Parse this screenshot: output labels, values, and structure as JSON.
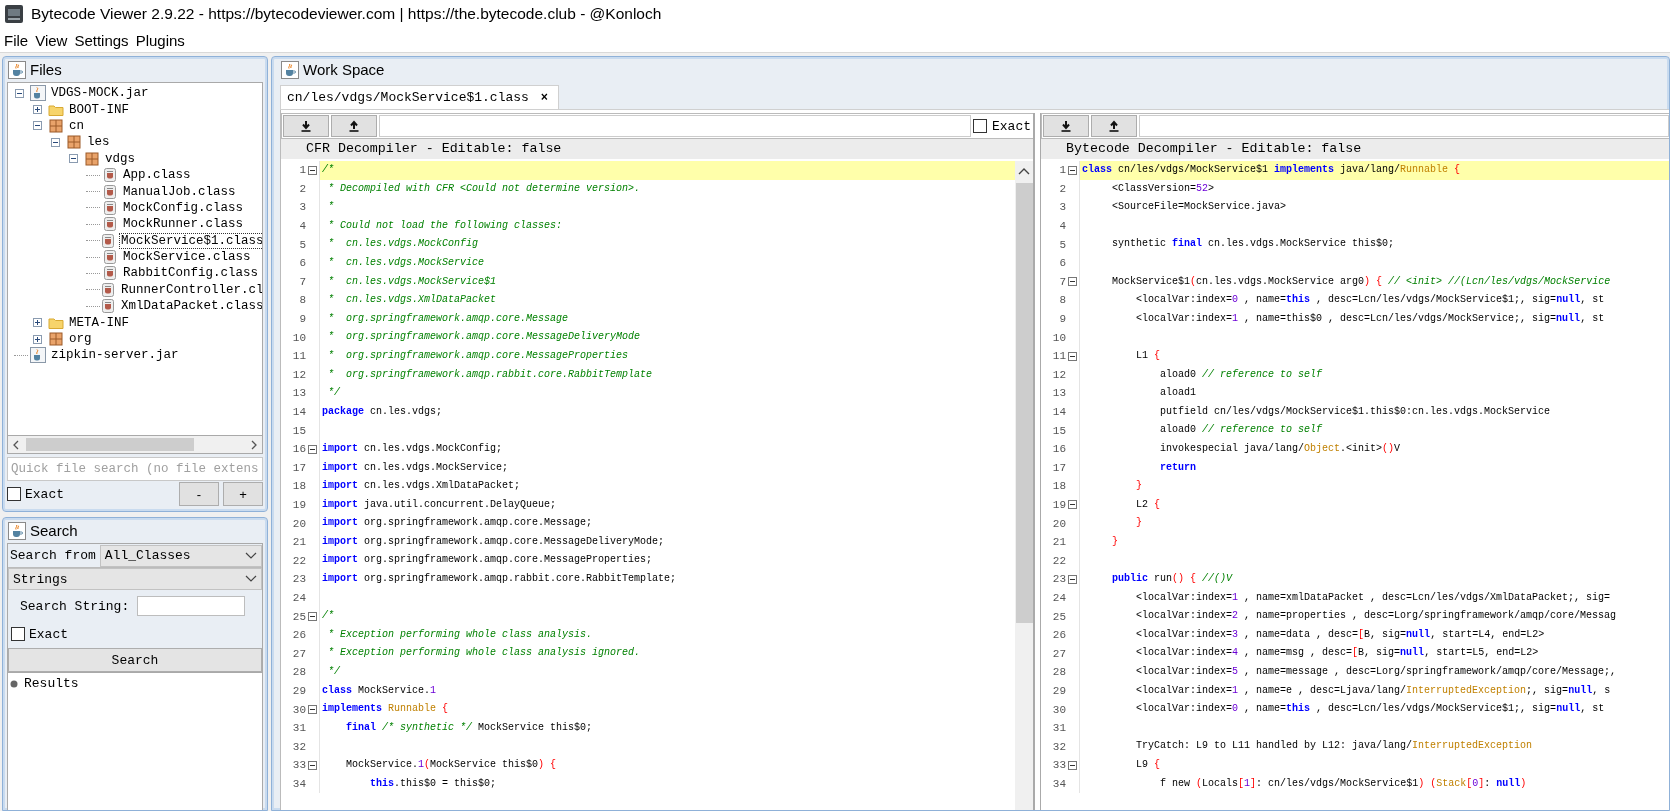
{
  "window": {
    "title": "Bytecode Viewer 2.9.22 - https://bytecodeviewer.com | https://the.bytecode.club - @Konloch"
  },
  "menu": [
    "File",
    "View",
    "Settings",
    "Plugins"
  ],
  "files_panel": {
    "title": "Files",
    "tree": [
      {
        "label": "VDGS-MOCK.jar",
        "kind": "jar",
        "expanded": true,
        "selected": false,
        "children": [
          {
            "label": "BOOT-INF",
            "kind": "folder",
            "expanded": false,
            "selected": false
          },
          {
            "label": "cn",
            "kind": "package",
            "expanded": true,
            "selected": false,
            "children": [
              {
                "label": "les",
                "kind": "package",
                "expanded": true,
                "selected": false,
                "children": [
                  {
                    "label": "vdgs",
                    "kind": "package",
                    "expanded": true,
                    "selected": false,
                    "children": [
                      {
                        "label": "App.class",
                        "kind": "class",
                        "selected": false
                      },
                      {
                        "label": "ManualJob.class",
                        "kind": "class",
                        "selected": false
                      },
                      {
                        "label": "MockConfig.class",
                        "kind": "class",
                        "selected": false
                      },
                      {
                        "label": "MockRunner.class",
                        "kind": "class",
                        "selected": false
                      },
                      {
                        "label": "MockService$1.class",
                        "kind": "class",
                        "selected": true
                      },
                      {
                        "label": "MockService.class",
                        "kind": "class",
                        "selected": false
                      },
                      {
                        "label": "RabbitConfig.class",
                        "kind": "class",
                        "selected": false
                      },
                      {
                        "label": "RunnerController.cl",
                        "kind": "class",
                        "selected": false
                      },
                      {
                        "label": "XmlDataPacket.class",
                        "kind": "class",
                        "selected": false
                      }
                    ]
                  }
                ]
              }
            ]
          },
          {
            "label": "META-INF",
            "kind": "folder",
            "expanded": false,
            "selected": false
          },
          {
            "label": "org",
            "kind": "package",
            "expanded": false,
            "selected": false
          }
        ]
      },
      {
        "label": "zipkin-server.jar",
        "kind": "jar",
        "selected": false
      }
    ],
    "quick_search": {
      "placeholder": "Quick file search (no file extens"
    },
    "exact": {
      "label": "Exact",
      "checked": false
    },
    "buttons": [
      "-",
      "+"
    ]
  },
  "search_panel": {
    "title": "Search",
    "search_from_label": "Search from",
    "search_from": "All_Classes",
    "mode": "Strings",
    "string_label": "Search String:",
    "exact": {
      "label": "Exact",
      "checked": false
    },
    "button": "Search",
    "results": [
      "Results"
    ]
  },
  "workspace": {
    "title": "Work Space",
    "tabs": [
      {
        "label": "cn/les/vdgs/MockService$1.class",
        "close": "×",
        "selected": true
      }
    ],
    "panes": [
      {
        "header": "CFR Decompiler - Editable: false",
        "exact": {
          "label": "Exact",
          "checked": false
        },
        "lines": [
          {
            "number": "1",
            "fold": true,
            "highlighted": true,
            "tokens": [
              {
                "kind": "comment",
                "text": "/*"
              }
            ]
          },
          {
            "number": "2",
            "fold": false,
            "highlighted": false,
            "tokens": [
              {
                "kind": "comment",
                "text": " * Decompiled with CFR <Could not determine version>."
              }
            ]
          },
          {
            "number": "3",
            "fold": false,
            "highlighted": false,
            "tokens": [
              {
                "kind": "comment",
                "text": " *"
              }
            ]
          },
          {
            "number": "4",
            "fold": false,
            "highlighted": false,
            "tokens": [
              {
                "kind": "comment",
                "text": " * Could not load the following classes:"
              }
            ]
          },
          {
            "number": "5",
            "fold": false,
            "highlighted": false,
            "tokens": [
              {
                "kind": "comment",
                "text": " *  cn.les.vdgs.MockConfig"
              }
            ]
          },
          {
            "number": "6",
            "fold": false,
            "highlighted": false,
            "tokens": [
              {
                "kind": "comment",
                "text": " *  cn.les.vdgs.MockService"
              }
            ]
          },
          {
            "number": "7",
            "fold": false,
            "highlighted": false,
            "tokens": [
              {
                "kind": "comment",
                "text": " *  cn.les.vdgs.MockService$1"
              }
            ]
          },
          {
            "number": "8",
            "fold": false,
            "highlighted": false,
            "tokens": [
              {
                "kind": "comment",
                "text": " *  cn.les.vdgs.XmlDataPacket"
              }
            ]
          },
          {
            "number": "9",
            "fold": false,
            "highlighted": false,
            "tokens": [
              {
                "kind": "comment",
                "text": " *  org.springframework.amqp.core.Message"
              }
            ]
          },
          {
            "number": "10",
            "fold": false,
            "highlighted": false,
            "tokens": [
              {
                "kind": "comment",
                "text": " *  org.springframework.amqp.core.MessageDeliveryMode"
              }
            ]
          },
          {
            "number": "11",
            "fold": false,
            "highlighted": false,
            "tokens": [
              {
                "kind": "comment",
                "text": " *  org.springframework.amqp.core.MessageProperties"
              }
            ]
          },
          {
            "number": "12",
            "fold": false,
            "highlighted": false,
            "tokens": [
              {
                "kind": "comment",
                "text": " *  org.springframework.amqp.rabbit.core.RabbitTemplate"
              }
            ]
          },
          {
            "number": "13",
            "fold": false,
            "highlighted": false,
            "tokens": [
              {
                "kind": "comment",
                "text": " */"
              }
            ]
          },
          {
            "number": "14",
            "fold": false,
            "highlighted": false,
            "tokens": [
              {
                "kind": "keyword",
                "text": "package"
              },
              {
                "kind": "plain",
                "text": " cn.les.vdgs;"
              }
            ]
          },
          {
            "number": "15",
            "fold": false,
            "highlighted": false
          },
          {
            "number": "16",
            "fold": true,
            "highlighted": false,
            "tokens": [
              {
                "kind": "keyword",
                "text": "import"
              },
              {
                "kind": "plain",
                "text": " cn.les.vdgs.MockConfig;"
              }
            ]
          },
          {
            "number": "17",
            "fold": false,
            "highlighted": false,
            "tokens": [
              {
                "kind": "keyword",
                "text": "import"
              },
              {
                "kind": "plain",
                "text": " cn.les.vdgs.MockService;"
              }
            ]
          },
          {
            "number": "18",
            "fold": false,
            "highlighted": false,
            "tokens": [
              {
                "kind": "keyword",
                "text": "import"
              },
              {
                "kind": "plain",
                "text": " cn.les.vdgs.XmlDataPacket;"
              }
            ]
          },
          {
            "number": "19",
            "fold": false,
            "highlighted": false,
            "tokens": [
              {
                "kind": "keyword",
                "text": "import"
              },
              {
                "kind": "plain",
                "text": " java.util.concurrent.DelayQueue;"
              }
            ]
          },
          {
            "number": "20",
            "fold": false,
            "highlighted": false,
            "tokens": [
              {
                "kind": "keyword",
                "text": "import"
              },
              {
                "kind": "plain",
                "text": " org.springframework.amqp.core.Message;"
              }
            ]
          },
          {
            "number": "21",
            "fold": false,
            "highlighted": false,
            "tokens": [
              {
                "kind": "keyword",
                "text": "import"
              },
              {
                "kind": "plain",
                "text": " org.springframework.amqp.core.MessageDeliveryMode;"
              }
            ]
          },
          {
            "number": "22",
            "fold": false,
            "highlighted": false,
            "tokens": [
              {
                "kind": "keyword",
                "text": "import"
              },
              {
                "kind": "plain",
                "text": " org.springframework.amqp.core.MessageProperties;"
              }
            ]
          },
          {
            "number": "23",
            "fold": false,
            "highlighted": false,
            "tokens": [
              {
                "kind": "keyword",
                "text": "import"
              },
              {
                "kind": "plain",
                "text": " org.springframework.amqp.rabbit.core.RabbitTemplate;"
              }
            ]
          },
          {
            "number": "24",
            "fold": false,
            "highlighted": false
          },
          {
            "number": "25",
            "fold": true,
            "highlighted": false,
            "tokens": [
              {
                "kind": "comment",
                "text": "/*"
              }
            ]
          },
          {
            "number": "26",
            "fold": false,
            "highlighted": false,
            "tokens": [
              {
                "kind": "comment",
                "text": " * Exception performing whole class analysis."
              }
            ]
          },
          {
            "number": "27",
            "fold": false,
            "highlighted": false,
            "tokens": [
              {
                "kind": "comment",
                "text": " * Exception performing whole class analysis ignored."
              }
            ]
          },
          {
            "number": "28",
            "fold": false,
            "highlighted": false,
            "tokens": [
              {
                "kind": "comment",
                "text": " */"
              }
            ]
          },
          {
            "number": "29",
            "fold": false,
            "highlighted": false,
            "tokens": [
              {
                "kind": "keyword",
                "text": "class"
              },
              {
                "kind": "plain",
                "text": " MockService."
              },
              {
                "kind": "number",
                "text": "1"
              }
            ]
          },
          {
            "number": "30",
            "fold": true,
            "highlighted": false,
            "tokens": [
              {
                "kind": "keyword",
                "text": "implements"
              },
              {
                "kind": "type",
                "text": " Runnable"
              },
              {
                "kind": "brace",
                "text": " {"
              }
            ]
          },
          {
            "number": "31",
            "fold": false,
            "highlighted": false,
            "tokens": [
              {
                "kind": "keyword",
                "text": "    final"
              },
              {
                "kind": "comment",
                "text": " /* synthetic */"
              },
              {
                "kind": "plain",
                "text": " MockService this$0;"
              }
            ]
          },
          {
            "number": "32",
            "fold": false,
            "highlighted": false
          },
          {
            "number": "33",
            "fold": true,
            "highlighted": false,
            "tokens": [
              {
                "kind": "plain",
                "text": "    MockService."
              },
              {
                "kind": "number",
                "text": "1"
              },
              {
                "kind": "brace",
                "text": "("
              },
              {
                "kind": "plain",
                "text": "MockService this$0"
              },
              {
                "kind": "brace",
                "text": ") {"
              }
            ]
          },
          {
            "number": "34",
            "fold": false,
            "highlighted": false,
            "tokens": [
              {
                "kind": "keyword",
                "text": "        this"
              },
              {
                "kind": "plain",
                "text": ".this$0 = this$0;"
              }
            ]
          }
        ]
      },
      {
        "header": "Bytecode Decompiler - Editable: false",
        "lines": [
          {
            "number": "1",
            "fold": true,
            "highlighted": true,
            "tokens": [
              {
                "kind": "keyword",
                "text": "class"
              },
              {
                "kind": "plain",
                "text": " cn/les/vdgs/MockService$1 "
              },
              {
                "kind": "keyword",
                "text": "implements"
              },
              {
                "kind": "plain",
                "text": " java/lang/"
              },
              {
                "kind": "type",
                "text": "Runnable"
              },
              {
                "kind": "brace",
                "text": " {"
              }
            ]
          },
          {
            "number": "2",
            "fold": false,
            "highlighted": false,
            "tokens": [
              {
                "kind": "plain",
                "text": "     <ClassVersion="
              },
              {
                "kind": "number",
                "text": "52"
              },
              {
                "kind": "plain",
                "text": ">"
              }
            ]
          },
          {
            "number": "3",
            "fold": false,
            "highlighted": false,
            "tokens": [
              {
                "kind": "plain",
                "text": "     <SourceFile=MockService.java>"
              }
            ]
          },
          {
            "number": "4",
            "fold": false,
            "highlighted": false
          },
          {
            "number": "5",
            "fold": false,
            "highlighted": false,
            "tokens": [
              {
                "kind": "plain",
                "text": "     synthetic "
              },
              {
                "kind": "keyword",
                "text": "final"
              },
              {
                "kind": "plain",
                "text": " cn.les.vdgs.MockService this$0;"
              }
            ]
          },
          {
            "number": "6",
            "fold": false,
            "highlighted": false
          },
          {
            "number": "7",
            "fold": true,
            "highlighted": false,
            "tokens": [
              {
                "kind": "plain",
                "text": "     MockService$1"
              },
              {
                "kind": "brace",
                "text": "("
              },
              {
                "kind": "plain",
                "text": "cn.les.vdgs.MockService arg0"
              },
              {
                "kind": "brace",
                "text": ") {"
              },
              {
                "kind": "comment",
                "text": " // <init> //(Lcn/les/vdgs/MockService"
              }
            ]
          },
          {
            "number": "8",
            "fold": false,
            "highlighted": false,
            "tokens": [
              {
                "kind": "plain",
                "text": "         <localVar:index="
              },
              {
                "kind": "number",
                "text": "0"
              },
              {
                "kind": "plain",
                "text": " , name="
              },
              {
                "kind": "keyword",
                "text": "this"
              },
              {
                "kind": "plain",
                "text": " , desc=Lcn/les/vdgs/MockService$1;, sig="
              },
              {
                "kind": "keyword",
                "text": "null"
              },
              {
                "kind": "plain",
                "text": ", st"
              }
            ]
          },
          {
            "number": "9",
            "fold": false,
            "highlighted": false,
            "tokens": [
              {
                "kind": "plain",
                "text": "         <localVar:index="
              },
              {
                "kind": "number",
                "text": "1"
              },
              {
                "kind": "plain",
                "text": " , name=this$0 , desc=Lcn/les/vdgs/MockService;, sig="
              },
              {
                "kind": "keyword",
                "text": "null"
              },
              {
                "kind": "plain",
                "text": ", st"
              }
            ]
          },
          {
            "number": "10",
            "fold": false,
            "highlighted": false
          },
          {
            "number": "11",
            "fold": true,
            "highlighted": false,
            "tokens": [
              {
                "kind": "plain",
                "text": "         L1"
              },
              {
                "kind": "brace",
                "text": " {"
              }
            ]
          },
          {
            "number": "12",
            "fold": false,
            "highlighted": false,
            "tokens": [
              {
                "kind": "plain",
                "text": "             aload0"
              },
              {
                "kind": "comment",
                "text": " // reference to self"
              }
            ]
          },
          {
            "number": "13",
            "fold": false,
            "highlighted": false,
            "tokens": [
              {
                "kind": "plain",
                "text": "             aload1"
              }
            ]
          },
          {
            "number": "14",
            "fold": false,
            "highlighted": false,
            "tokens": [
              {
                "kind": "plain",
                "text": "             putfield cn/les/vdgs/MockService$1.this$0:cn.les.vdgs.MockService"
              }
            ]
          },
          {
            "number": "15",
            "fold": false,
            "highlighted": false,
            "tokens": [
              {
                "kind": "plain",
                "text": "             aload0"
              },
              {
                "kind": "comment",
                "text": " // reference to self"
              }
            ]
          },
          {
            "number": "16",
            "fold": false,
            "highlighted": false,
            "tokens": [
              {
                "kind": "plain",
                "text": "             invokespecial java/lang/"
              },
              {
                "kind": "type",
                "text": "Object"
              },
              {
                "kind": "plain",
                "text": ".<init>"
              },
              {
                "kind": "brace",
                "text": "()"
              },
              {
                "kind": "plain",
                "text": "V"
              }
            ]
          },
          {
            "number": "17",
            "fold": false,
            "highlighted": false,
            "tokens": [
              {
                "kind": "keyword",
                "text": "             return"
              }
            ]
          },
          {
            "number": "18",
            "fold": false,
            "highlighted": false,
            "tokens": [
              {
                "kind": "brace",
                "text": "         }"
              }
            ]
          },
          {
            "number": "19",
            "fold": true,
            "highlighted": false,
            "tokens": [
              {
                "kind": "plain",
                "text": "         L2"
              },
              {
                "kind": "brace",
                "text": " {"
              }
            ]
          },
          {
            "number": "20",
            "fold": false,
            "highlighted": false,
            "tokens": [
              {
                "kind": "brace",
                "text": "         }"
              }
            ]
          },
          {
            "number": "21",
            "fold": false,
            "highlighted": false,
            "tokens": [
              {
                "kind": "brace",
                "text": "     }"
              }
            ]
          },
          {
            "number": "22",
            "fold": false,
            "highlighted": false
          },
          {
            "number": "23",
            "fold": true,
            "highlighted": false,
            "tokens": [
              {
                "kind": "keyword",
                "text": "     public"
              },
              {
                "kind": "plain",
                "text": " run"
              },
              {
                "kind": "brace",
                "text": "() {"
              },
              {
                "kind": "comment",
                "text": " //()V"
              }
            ]
          },
          {
            "number": "24",
            "fold": false,
            "highlighted": false,
            "tokens": [
              {
                "kind": "plain",
                "text": "         <localVar:index="
              },
              {
                "kind": "number",
                "text": "1"
              },
              {
                "kind": "plain",
                "text": " , name=xmlDataPacket , desc=Lcn/les/vdgs/XmlDataPacket;, sig="
              }
            ]
          },
          {
            "number": "25",
            "fold": false,
            "highlighted": false,
            "tokens": [
              {
                "kind": "plain",
                "text": "         <localVar:index="
              },
              {
                "kind": "number",
                "text": "2"
              },
              {
                "kind": "plain",
                "text": " , name=properties , desc=Lorg/springframework/amqp/core/Messag"
              }
            ]
          },
          {
            "number": "26",
            "fold": false,
            "highlighted": false,
            "tokens": [
              {
                "kind": "plain",
                "text": "         <localVar:index="
              },
              {
                "kind": "number",
                "text": "3"
              },
              {
                "kind": "plain",
                "text": " , name=data , desc="
              },
              {
                "kind": "brace",
                "text": "["
              },
              {
                "kind": "plain",
                "text": "B, sig="
              },
              {
                "kind": "keyword",
                "text": "null"
              },
              {
                "kind": "plain",
                "text": ", start=L4, end=L2>"
              }
            ]
          },
          {
            "number": "27",
            "fold": false,
            "highlighted": false,
            "tokens": [
              {
                "kind": "plain",
                "text": "         <localVar:index="
              },
              {
                "kind": "number",
                "text": "4"
              },
              {
                "kind": "plain",
                "text": " , name=msg , desc="
              },
              {
                "kind": "brace",
                "text": "["
              },
              {
                "kind": "plain",
                "text": "B, sig="
              },
              {
                "kind": "keyword",
                "text": "null"
              },
              {
                "kind": "plain",
                "text": ", start=L5, end=L2>"
              }
            ]
          },
          {
            "number": "28",
            "fold": false,
            "highlighted": false,
            "tokens": [
              {
                "kind": "plain",
                "text": "         <localVar:index="
              },
              {
                "kind": "number",
                "text": "5"
              },
              {
                "kind": "plain",
                "text": " , name=message , desc=Lorg/springframework/amqp/core/Message;,"
              }
            ]
          },
          {
            "number": "29",
            "fold": false,
            "highlighted": false,
            "tokens": [
              {
                "kind": "plain",
                "text": "         <localVar:index="
              },
              {
                "kind": "number",
                "text": "1"
              },
              {
                "kind": "plain",
                "text": " , name=e , desc=Ljava/lang/"
              },
              {
                "kind": "type",
                "text": "InterruptedException"
              },
              {
                "kind": "plain",
                "text": ";, sig="
              },
              {
                "kind": "keyword",
                "text": "null"
              },
              {
                "kind": "plain",
                "text": ", s"
              }
            ]
          },
          {
            "number": "30",
            "fold": false,
            "highlighted": false,
            "tokens": [
              {
                "kind": "plain",
                "text": "         <localVar:index="
              },
              {
                "kind": "number",
                "text": "0"
              },
              {
                "kind": "plain",
                "text": " , name="
              },
              {
                "kind": "keyword",
                "text": "this"
              },
              {
                "kind": "plain",
                "text": " , desc=Lcn/les/vdgs/MockService$1;, sig="
              },
              {
                "kind": "keyword",
                "text": "null"
              },
              {
                "kind": "plain",
                "text": ", st"
              }
            ]
          },
          {
            "number": "31",
            "fold": false,
            "highlighted": false
          },
          {
            "number": "32",
            "fold": false,
            "highlighted": false,
            "tokens": [
              {
                "kind": "plain",
                "text": "         TryCatch: L9 to L11 handled by L12: java/lang/"
              },
              {
                "kind": "type",
                "text": "InterruptedException"
              }
            ]
          },
          {
            "number": "33",
            "fold": true,
            "highlighted": false,
            "tokens": [
              {
                "kind": "plain",
                "text": "         L9"
              },
              {
                "kind": "brace",
                "text": " {"
              }
            ]
          },
          {
            "number": "34",
            "fold": false,
            "highlighted": false,
            "tokens": [
              {
                "kind": "plain",
                "text": "             f new"
              },
              {
                "kind": "brace",
                "text": " ("
              },
              {
                "kind": "plain",
                "text": "Locals"
              },
              {
                "kind": "brace",
                "text": "["
              },
              {
                "kind": "number",
                "text": "1"
              },
              {
                "kind": "brace",
                "text": "]"
              },
              {
                "kind": "plain",
                "text": ": cn/les/vdgs/MockService$1"
              },
              {
                "kind": "brace",
                "text": ") ("
              },
              {
                "kind": "type",
                "text": "Stack"
              },
              {
                "kind": "brace",
                "text": "["
              },
              {
                "kind": "number",
                "text": "0"
              },
              {
                "kind": "brace",
                "text": "]"
              },
              {
                "kind": "plain",
                "text": ": "
              },
              {
                "kind": "keyword",
                "text": "null"
              },
              {
                "kind": "brace",
                "text": ")"
              }
            ]
          }
        ]
      }
    ]
  }
}
